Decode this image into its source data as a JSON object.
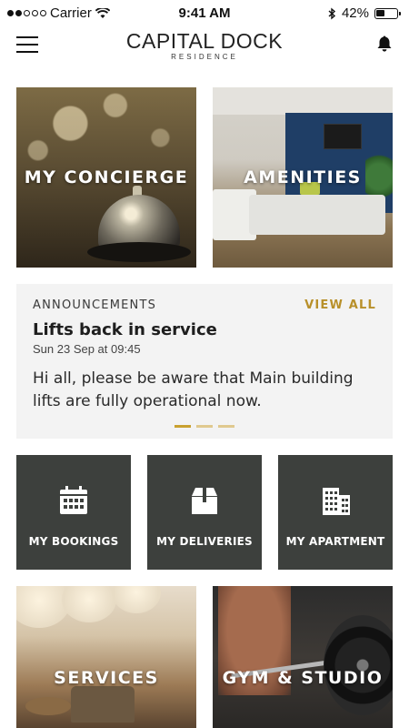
{
  "status_bar": {
    "carrier": "Carrier",
    "time": "9:41 AM",
    "battery": "42%",
    "battery_level": 0.42,
    "signal_bars_filled": 2,
    "signal_bars_total": 5
  },
  "header": {
    "brand_name": "CAPITAL DOCK",
    "brand_sub": "RESIDENCE",
    "menu_icon": "hamburger-menu-icon",
    "notifications_icon": "bell-icon"
  },
  "tiles": {
    "concierge": "MY CONCIERGE",
    "amenities": "AMENITIES",
    "services": "SERVICES",
    "gym": "GYM & STUDIO"
  },
  "announcements": {
    "heading": "ANNOUNCEMENTS",
    "view_all": "VIEW ALL",
    "title": "Lifts back in service",
    "date": "Sun 23 Sep at 09:45",
    "body": "Hi all, please be aware that Main building lifts are fully operational now.",
    "page_count": 3,
    "active_page": 1
  },
  "shortcuts": [
    {
      "label": "MY BOOKINGS",
      "icon": "calendar-icon"
    },
    {
      "label": "MY DELIVERIES",
      "icon": "package-icon"
    },
    {
      "label": "MY APARTMENT",
      "icon": "building-icon"
    }
  ],
  "colors": {
    "accent": "#c9a12f",
    "tile_dark": "#3d403d",
    "panel": "#f3f3f3"
  }
}
